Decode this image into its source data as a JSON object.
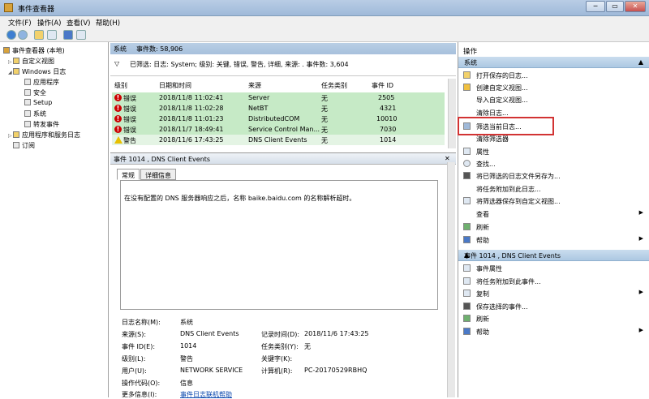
{
  "window": {
    "title": "事件查看器",
    "min": "─",
    "max": "▭",
    "close": "✕"
  },
  "menu": [
    "文件(F)",
    "操作(A)",
    "查看(V)",
    "帮助(H)"
  ],
  "tree": {
    "root": "事件查看器 (本地)",
    "custom_views": "自定义视图",
    "windows_logs": "Windows 日志",
    "children": [
      "应用程序",
      "安全",
      "Setup",
      "系统",
      "转发事件"
    ],
    "app_services": "应用程序和服务日志",
    "subscriptions": "订阅"
  },
  "log_header": {
    "name": "系统",
    "count_label": "事件数: 58,906"
  },
  "filter_text": "已筛选: 日志: System; 级别: 关键, 错误, 警告, 详细, 来源: . 事件数: 3,604",
  "columns": [
    "级别",
    "日期和时间",
    "来源",
    "任务类别",
    "事件 ID"
  ],
  "events": [
    {
      "level": "错误",
      "type": "error",
      "datetime": "2018/11/8 11:02:41",
      "source": "Server",
      "task": "无",
      "id": "2505"
    },
    {
      "level": "错误",
      "type": "error",
      "datetime": "2018/11/8 11:02:28",
      "source": "NetBT",
      "task": "无",
      "id": "4321"
    },
    {
      "level": "错误",
      "type": "error",
      "datetime": "2018/11/8 11:01:23",
      "source": "DistributedCOM",
      "task": "无",
      "id": "10010"
    },
    {
      "level": "错误",
      "type": "error",
      "datetime": "2018/11/7 18:49:41",
      "source": "Service Control Man...",
      "task": "无",
      "id": "7030"
    },
    {
      "level": "警告",
      "type": "warning",
      "datetime": "2018/11/6 17:43:25",
      "source": "DNS Client Events",
      "task": "无",
      "id": "1014"
    }
  ],
  "detail": {
    "header": "事件 1014 , DNS Client Events",
    "tab_general": "常规",
    "tab_details": "详细信息",
    "message": "在没有配置的 DNS 服务器响应之后，名称 baike.baidu.com 的名称解析超时。",
    "close": "✕",
    "props": {
      "log_name_label": "日志名称(M):",
      "log_name": "系统",
      "source_label": "来源(S):",
      "source": "DNS Client Events",
      "logged_label": "记录时间(D):",
      "logged": "2018/11/6 17:43:25",
      "event_id_label": "事件 ID(E):",
      "event_id": "1014",
      "task_label": "任务类别(Y):",
      "task": "无",
      "level_label": "级别(L):",
      "level": "警告",
      "keywords_label": "关键字(K):",
      "keywords": "",
      "user_label": "用户(U):",
      "user": "NETWORK SERVICE",
      "computer_label": "计算机(R):",
      "computer": "PC-20170529RBHQ",
      "opcode_label": "操作代码(O):",
      "opcode": "信息",
      "more_label": "更多信息(I):",
      "more_link": "事件日志联机帮助"
    }
  },
  "actions": {
    "title": "操作",
    "section1": "系统",
    "items1": [
      "打开保存的日志...",
      "创建自定义视图...",
      "导入自定义视图...",
      "清除日志...",
      "筛选当前日志...",
      "清除筛选器",
      "属性",
      "查找...",
      "将已筛选的日志文件另存为...",
      "将任务附加到此日志...",
      "将筛选器保存到自定义视图...",
      "查看",
      "刷新",
      "帮助"
    ],
    "section2": "事件 1014 , DNS Client Events",
    "items2": [
      "事件属性",
      "将任务附加到此事件...",
      "复制",
      "保存选择的事件...",
      "刷新",
      "帮助"
    ]
  }
}
